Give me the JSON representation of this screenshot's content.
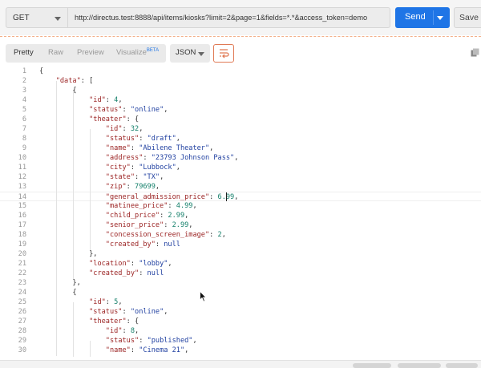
{
  "request": {
    "method": "GET",
    "url": "http://directus.test:8888/api/items/kiosks?limit=2&page=1&fields=*.*&access_token=demo",
    "send_label": "Send",
    "save_label": "Save"
  },
  "response_toolbar": {
    "tabs": [
      {
        "label": "Pretty",
        "active": true
      },
      {
        "label": "Raw",
        "active": false
      },
      {
        "label": "Preview",
        "active": false
      },
      {
        "label": "Visualize",
        "active": false,
        "badge": "BETA"
      }
    ],
    "format": "JSON"
  },
  "code": {
    "current_line": 14,
    "lines": [
      [
        {
          "t": "{"
        }
      ],
      [
        {
          "t": "    "
        },
        {
          "t": "\"data\"",
          "c": "key"
        },
        {
          "t": ": ["
        }
      ],
      [
        {
          "t": "        {"
        }
      ],
      [
        {
          "t": "            "
        },
        {
          "t": "\"id\"",
          "c": "key"
        },
        {
          "t": ": "
        },
        {
          "t": "4",
          "c": "num"
        },
        {
          "t": ","
        }
      ],
      [
        {
          "t": "            "
        },
        {
          "t": "\"status\"",
          "c": "key"
        },
        {
          "t": ": "
        },
        {
          "t": "\"online\"",
          "c": "str"
        },
        {
          "t": ","
        }
      ],
      [
        {
          "t": "            "
        },
        {
          "t": "\"theater\"",
          "c": "key"
        },
        {
          "t": ": {"
        }
      ],
      [
        {
          "t": "                "
        },
        {
          "t": "\"id\"",
          "c": "key"
        },
        {
          "t": ": "
        },
        {
          "t": "32",
          "c": "num"
        },
        {
          "t": ","
        }
      ],
      [
        {
          "t": "                "
        },
        {
          "t": "\"status\"",
          "c": "key"
        },
        {
          "t": ": "
        },
        {
          "t": "\"draft\"",
          "c": "str"
        },
        {
          "t": ","
        }
      ],
      [
        {
          "t": "                "
        },
        {
          "t": "\"name\"",
          "c": "key"
        },
        {
          "t": ": "
        },
        {
          "t": "\"Abilene Theater\"",
          "c": "str"
        },
        {
          "t": ","
        }
      ],
      [
        {
          "t": "                "
        },
        {
          "t": "\"address\"",
          "c": "key"
        },
        {
          "t": ": "
        },
        {
          "t": "\"23793 Johnson Pass\"",
          "c": "str"
        },
        {
          "t": ","
        }
      ],
      [
        {
          "t": "                "
        },
        {
          "t": "\"city\"",
          "c": "key"
        },
        {
          "t": ": "
        },
        {
          "t": "\"Lubbock\"",
          "c": "str"
        },
        {
          "t": ","
        }
      ],
      [
        {
          "t": "                "
        },
        {
          "t": "\"state\"",
          "c": "key"
        },
        {
          "t": ": "
        },
        {
          "t": "\"TX\"",
          "c": "str"
        },
        {
          "t": ","
        }
      ],
      [
        {
          "t": "                "
        },
        {
          "t": "\"zip\"",
          "c": "key"
        },
        {
          "t": ": "
        },
        {
          "t": "79699",
          "c": "num"
        },
        {
          "t": ","
        }
      ],
      [
        {
          "t": "                "
        },
        {
          "t": "\"general_admission_price\"",
          "c": "key"
        },
        {
          "t": ": "
        },
        {
          "t": "6.99",
          "c": "num"
        },
        {
          "t": ","
        }
      ],
      [
        {
          "t": "                "
        },
        {
          "t": "\"matinee_price\"",
          "c": "key"
        },
        {
          "t": ": "
        },
        {
          "t": "4.99",
          "c": "num"
        },
        {
          "t": ","
        }
      ],
      [
        {
          "t": "                "
        },
        {
          "t": "\"child_price\"",
          "c": "key"
        },
        {
          "t": ": "
        },
        {
          "t": "2.99",
          "c": "num"
        },
        {
          "t": ","
        }
      ],
      [
        {
          "t": "                "
        },
        {
          "t": "\"senior_price\"",
          "c": "key"
        },
        {
          "t": ": "
        },
        {
          "t": "2.99",
          "c": "num"
        },
        {
          "t": ","
        }
      ],
      [
        {
          "t": "                "
        },
        {
          "t": "\"concession_screen_image\"",
          "c": "key"
        },
        {
          "t": ": "
        },
        {
          "t": "2",
          "c": "num"
        },
        {
          "t": ","
        }
      ],
      [
        {
          "t": "                "
        },
        {
          "t": "\"created_by\"",
          "c": "key"
        },
        {
          "t": ": "
        },
        {
          "t": "null",
          "c": "lit"
        }
      ],
      [
        {
          "t": "            },"
        }
      ],
      [
        {
          "t": "            "
        },
        {
          "t": "\"location\"",
          "c": "key"
        },
        {
          "t": ": "
        },
        {
          "t": "\"lobby\"",
          "c": "str"
        },
        {
          "t": ","
        }
      ],
      [
        {
          "t": "            "
        },
        {
          "t": "\"created_by\"",
          "c": "key"
        },
        {
          "t": ": "
        },
        {
          "t": "null",
          "c": "lit"
        }
      ],
      [
        {
          "t": "        },"
        }
      ],
      [
        {
          "t": "        {"
        }
      ],
      [
        {
          "t": "            "
        },
        {
          "t": "\"id\"",
          "c": "key"
        },
        {
          "t": ": "
        },
        {
          "t": "5",
          "c": "num"
        },
        {
          "t": ","
        }
      ],
      [
        {
          "t": "            "
        },
        {
          "t": "\"status\"",
          "c": "key"
        },
        {
          "t": ": "
        },
        {
          "t": "\"online\"",
          "c": "str"
        },
        {
          "t": ","
        }
      ],
      [
        {
          "t": "            "
        },
        {
          "t": "\"theater\"",
          "c": "key"
        },
        {
          "t": ": {"
        }
      ],
      [
        {
          "t": "                "
        },
        {
          "t": "\"id\"",
          "c": "key"
        },
        {
          "t": ": "
        },
        {
          "t": "8",
          "c": "num"
        },
        {
          "t": ","
        }
      ],
      [
        {
          "t": "                "
        },
        {
          "t": "\"status\"",
          "c": "key"
        },
        {
          "t": ": "
        },
        {
          "t": "\"published\"",
          "c": "str"
        },
        {
          "t": ","
        }
      ],
      [
        {
          "t": "                "
        },
        {
          "t": "\"name\"",
          "c": "key"
        },
        {
          "t": ": "
        },
        {
          "t": "\"Cinema 21\"",
          "c": "str"
        },
        {
          "t": ","
        }
      ]
    ]
  },
  "icons": {
    "method_dropdown": "chevron-down-icon",
    "send_dropdown": "chevron-down-icon",
    "wrap": "wrap-lines-icon",
    "copy": "copy-icon",
    "mouse": "mouse-pointer-icon"
  },
  "colors": {
    "send": "#1f75e6",
    "accent_orange": "#e07a55",
    "json_key": "#9b2323",
    "json_string": "#1f3fa0",
    "json_number": "#15806b"
  }
}
